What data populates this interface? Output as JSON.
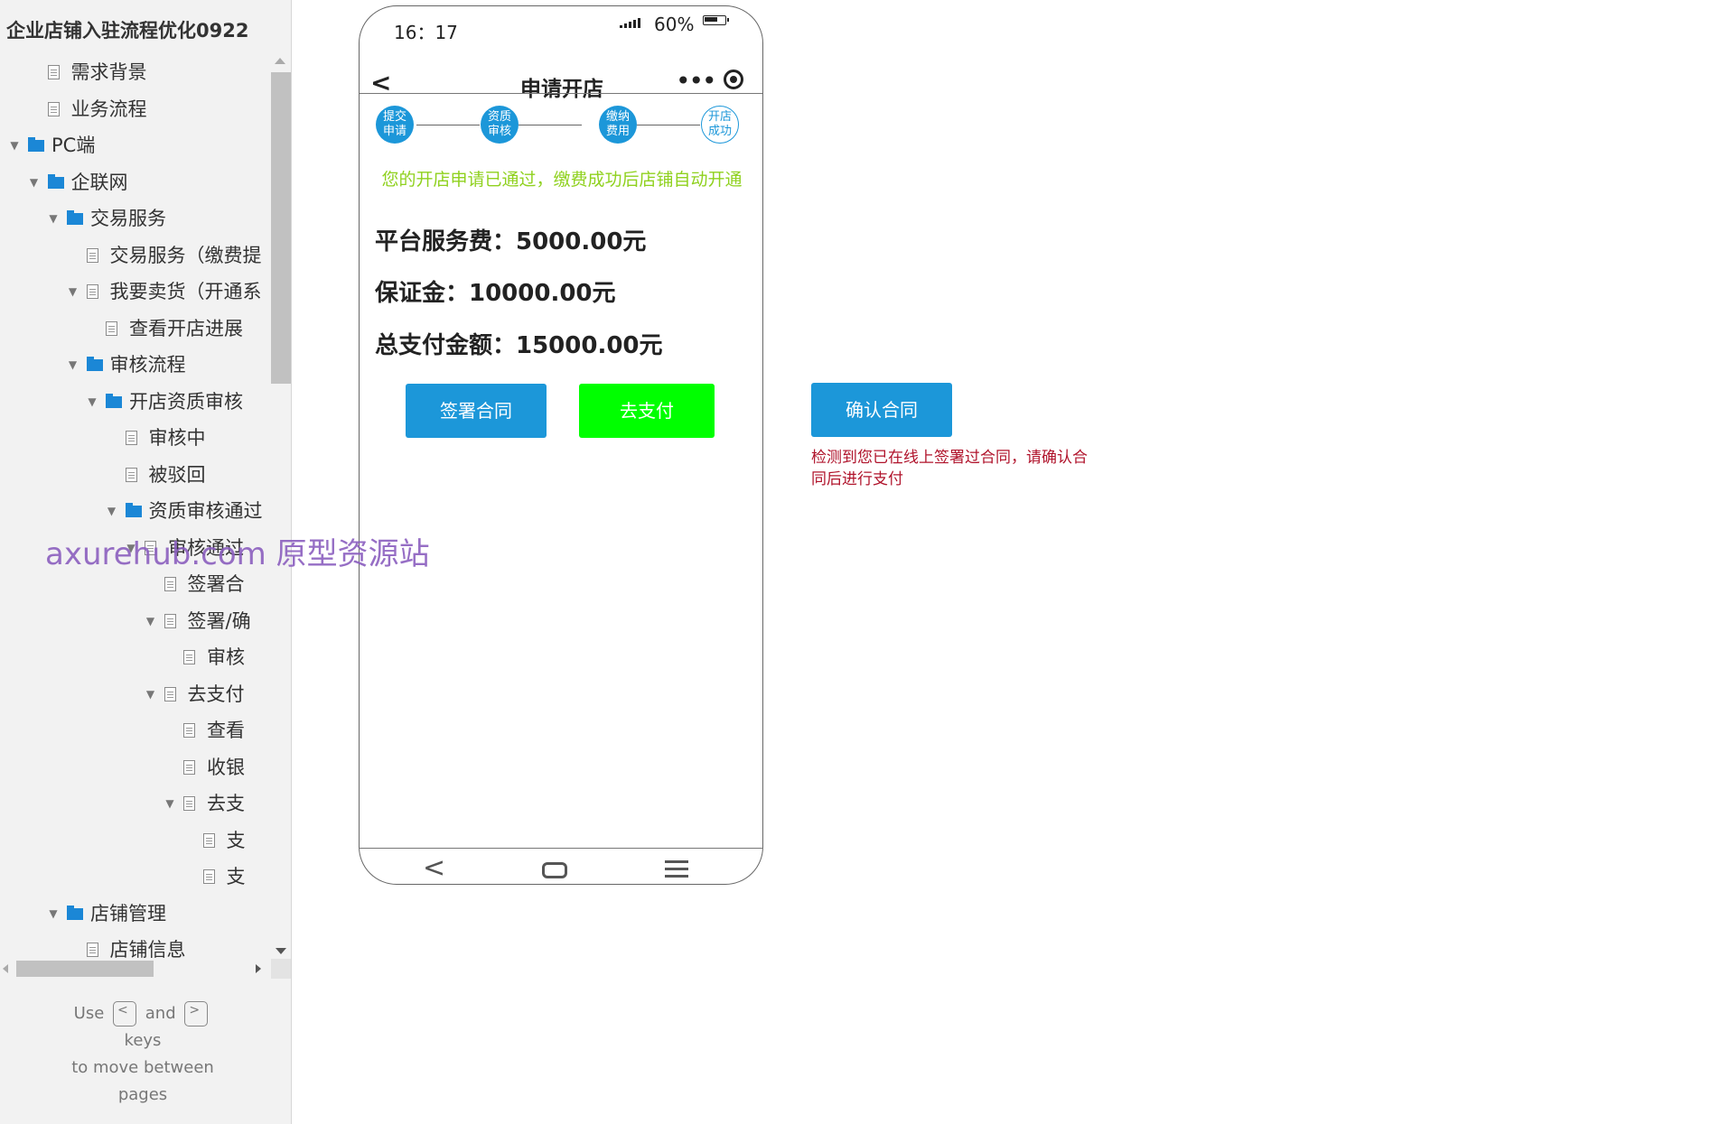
{
  "sidebar": {
    "project_title": "企业店铺入驻流程优化0922",
    "items": [
      {
        "label": "需求背景",
        "type": "page",
        "level": 1,
        "expanded": false
      },
      {
        "label": "业务流程",
        "type": "page",
        "level": 1,
        "expanded": false
      },
      {
        "label": "PC端",
        "type": "folder",
        "level": 0,
        "expanded": true
      },
      {
        "label": "企联网",
        "type": "folder",
        "level": 1,
        "expanded": true
      },
      {
        "label": "交易服务",
        "type": "folder",
        "level": 2,
        "expanded": true
      },
      {
        "label": "交易服务（缴费提",
        "type": "page",
        "level": 3,
        "expanded": false
      },
      {
        "label": "我要卖货（开通系",
        "type": "page",
        "level": 3,
        "expanded": true
      },
      {
        "label": "查看开店进展",
        "type": "page",
        "level": 4,
        "expanded": false
      },
      {
        "label": "审核流程",
        "type": "folder",
        "level": 3,
        "expanded": true
      },
      {
        "label": "开店资质审核",
        "type": "folder",
        "level": 4,
        "expanded": true
      },
      {
        "label": "审核中",
        "type": "page",
        "level": 5,
        "expanded": false
      },
      {
        "label": "被驳回",
        "type": "page",
        "level": 5,
        "expanded": false
      },
      {
        "label": "资质审核通过",
        "type": "folder",
        "level": 5,
        "expanded": true
      },
      {
        "label": "审核通过",
        "type": "page",
        "level": 6,
        "expanded": true
      },
      {
        "label": "签署合",
        "type": "page",
        "level": 7,
        "expanded": false
      },
      {
        "label": "签署/确",
        "type": "page",
        "level": 7,
        "expanded": true
      },
      {
        "label": "审核",
        "type": "page",
        "level": 8,
        "expanded": false
      },
      {
        "label": "去支付",
        "type": "page",
        "level": 7,
        "expanded": true
      },
      {
        "label": "查看",
        "type": "page",
        "level": 8,
        "expanded": false
      },
      {
        "label": "收银",
        "type": "page",
        "level": 8,
        "expanded": false
      },
      {
        "label": "去支",
        "type": "page",
        "level": 8,
        "expanded": true
      },
      {
        "label": "支",
        "type": "page",
        "level": 9,
        "expanded": false
      },
      {
        "label": "支",
        "type": "page",
        "level": 9,
        "expanded": false
      },
      {
        "label": "店铺管理",
        "type": "folder",
        "level": 2,
        "expanded": true
      },
      {
        "label": "店铺信息",
        "type": "page",
        "level": 3,
        "expanded": false
      }
    ],
    "hint": {
      "use": "Use",
      "and": "and",
      "keys": "keys",
      "line3": "to move between",
      "line4": "pages",
      "key_left": "<",
      "key_right": ">"
    }
  },
  "watermark": "axurehub.com 原型资源站",
  "phone": {
    "status_time": "16：17",
    "battery_percent": "60%",
    "nav_back": "<",
    "nav_title": "申请开店",
    "nav_more": "•••",
    "steps": [
      {
        "line1": "提交",
        "line2": "申请",
        "done": true
      },
      {
        "line1": "资质",
        "line2": "审核",
        "done": true
      },
      {
        "line1": "缴纳",
        "line2": "费用",
        "done": true
      },
      {
        "line1": "开店",
        "line2": "成功",
        "done": false
      }
    ],
    "notice": "您的开店申请已通过，缴费成功后店铺自动开通",
    "fees": {
      "service_fee": "平台服务费：5000.00元",
      "deposit": "保证金：10000.00元",
      "total": "总支付金额：15000.00元"
    },
    "buttons": {
      "sign_contract": "签署合同",
      "go_pay": "去支付"
    },
    "bottom_back": "<"
  },
  "confirm": {
    "button_label": "确认合同",
    "warning": "检测到您已在线上签署过合同，请确认合同后进行支付"
  },
  "colors": {
    "primary": "#1c97d9",
    "pay_green": "#00ff00",
    "notice_green": "#8fd11e",
    "warning_red": "#b0132b"
  }
}
